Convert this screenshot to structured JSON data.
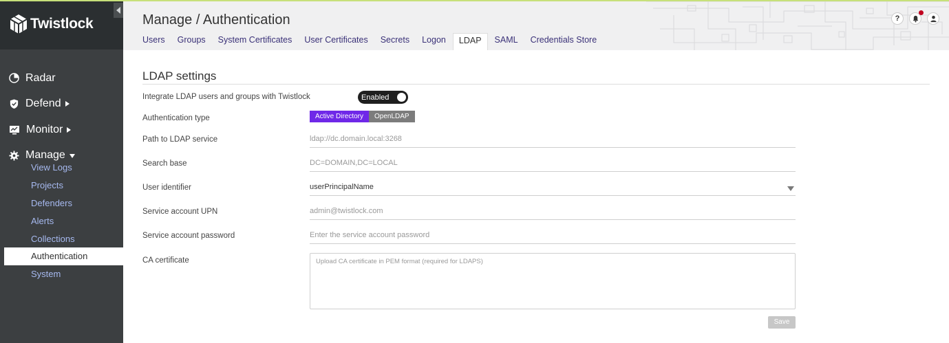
{
  "brand": {
    "name": "Twistlock",
    "logo_icon": "twistlock-cube-icon"
  },
  "sidebar": {
    "collapse_icon": "chevron-left-icon",
    "nav": [
      {
        "label": "Radar",
        "icon": "radar-icon"
      },
      {
        "label": "Defend",
        "icon": "shield-icon"
      },
      {
        "label": "Monitor",
        "icon": "monitor-icon"
      },
      {
        "label": "Manage",
        "icon": "gear-icon"
      }
    ],
    "manage_items": [
      {
        "label": "View Logs"
      },
      {
        "label": "Projects"
      },
      {
        "label": "Defenders"
      },
      {
        "label": "Alerts"
      },
      {
        "label": "Collections"
      },
      {
        "label": "Authentication",
        "active": true
      },
      {
        "label": "System"
      }
    ]
  },
  "header": {
    "title": "Manage / Authentication",
    "tabs": [
      {
        "label": "Users"
      },
      {
        "label": "Groups"
      },
      {
        "label": "System Certificates"
      },
      {
        "label": "User Certificates"
      },
      {
        "label": "Secrets"
      },
      {
        "label": "Logon"
      },
      {
        "label": "LDAP",
        "active": true
      },
      {
        "label": "SAML"
      },
      {
        "label": "Credentials Store"
      }
    ],
    "icons": {
      "help": "?",
      "notifications": "bell-icon",
      "user": "user-icon"
    }
  },
  "ldap": {
    "section_title": "LDAP settings",
    "integrate_label": "Integrate LDAP users and groups with Twistlock",
    "toggle_label": "Enabled",
    "auth_type_label": "Authentication type",
    "auth_options": [
      "Active Directory",
      "OpenLDAP"
    ],
    "auth_selected": "Active Directory",
    "path_label": "Path to LDAP service",
    "path_placeholder": "ldap://dc.domain.local:3268",
    "search_base_label": "Search base",
    "search_base_placeholder": "DC=DOMAIN,DC=LOCAL",
    "user_identifier_label": "User identifier",
    "user_identifier_value": "userPrincipalName",
    "upn_label": "Service account UPN",
    "upn_placeholder": "admin@twistlock.com",
    "password_label": "Service account password",
    "password_placeholder": "Enter the service account password",
    "ca_label": "CA certificate",
    "ca_placeholder": "Upload CA certificate in PEM format (required for LDAPS)",
    "save_label": "Save"
  },
  "colors": {
    "accent": "#6f28e8",
    "sidebar_bg": "#3c3f41",
    "sidebar_link": "#a6b9ef",
    "tab_text": "#3a3178"
  }
}
